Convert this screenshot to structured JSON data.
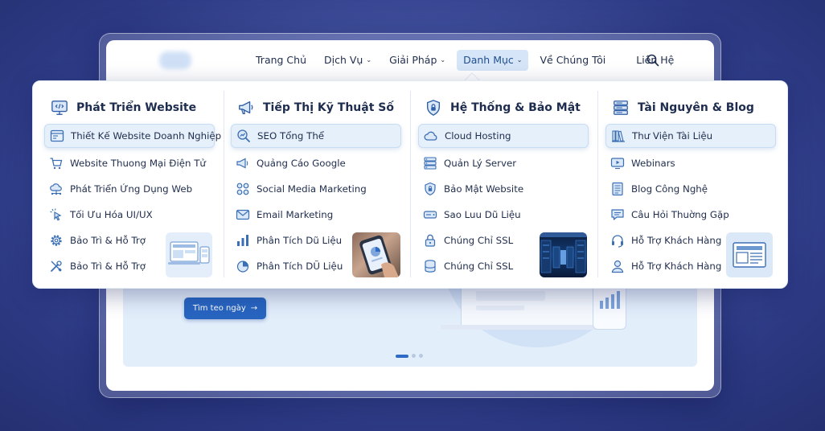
{
  "nav": {
    "items": [
      {
        "label": "Trang Chủ",
        "dropdown": false
      },
      {
        "label": "Dịch Vụ",
        "dropdown": true
      },
      {
        "label": "Giải Pháp",
        "dropdown": true
      },
      {
        "label": "Danh Mục",
        "dropdown": true,
        "active": true
      },
      {
        "label": "Về Chúng Tôi",
        "dropdown": false
      },
      {
        "label": "Liên Hệ",
        "dropdown": false
      }
    ],
    "chevron": "⌄"
  },
  "hero": {
    "button_label": "Tìm teo ngày",
    "button_arrow": "→"
  },
  "menu": {
    "columns": [
      {
        "title": "Phát Triển Website",
        "icon": "code-monitor-icon",
        "items": [
          {
            "label": "Thiết Kế Website Doanh Nghiệp",
            "icon": "browser-window-icon",
            "highlighted": true
          },
          {
            "label": "Website Thuong Mại Điện Tử",
            "icon": "shopping-cart-icon"
          },
          {
            "label": "Phát Triển Ứng Dụng Web",
            "icon": "cloud-network-icon"
          },
          {
            "label": "Tối Ưu Hóa UI/UX",
            "icon": "cursor-click-icon"
          },
          {
            "label": "Bảo Trì & Hỗ Trợ",
            "icon": "gear-icon"
          },
          {
            "label": "Bảo Trì & Hỗ Trợ",
            "icon": "tools-icon"
          }
        ]
      },
      {
        "title": "Tiếp Thị Kỹ Thuật Số",
        "icon": "megaphone-icon",
        "items": [
          {
            "label": "SEO Tổng Thể",
            "icon": "seo-search-icon",
            "highlighted": true
          },
          {
            "label": "Quảng Cáo Google",
            "icon": "megaphone-small-icon"
          },
          {
            "label": "Social Media Marketing",
            "icon": "social-dots-icon"
          },
          {
            "label": "Email Marketing",
            "icon": "envelope-icon"
          },
          {
            "label": "Phân Tích Dũ Liệu",
            "icon": "bar-chart-icon"
          },
          {
            "label": "Phân Tích DŨ Liệu",
            "icon": "pie-chart-icon"
          }
        ]
      },
      {
        "title": "Hệ Thống & Bảo Mật",
        "icon": "shield-lock-icon",
        "items": [
          {
            "label": "Cloud Hosting",
            "icon": "cloud-icon",
            "highlighted": true
          },
          {
            "label": "Quản Lý Server",
            "icon": "server-icon"
          },
          {
            "label": "Bảo Mật Website",
            "icon": "lock-shield-icon"
          },
          {
            "label": "Sao Luu Dũ Liệu",
            "icon": "hard-drive-icon"
          },
          {
            "label": "Chúng Chỉ SSL",
            "icon": "ssl-lock-icon"
          },
          {
            "label": "Chúng Chỉ SSL",
            "icon": "database-icon"
          }
        ]
      },
      {
        "title": "Tài Nguyên & Blog",
        "icon": "stack-icon",
        "items": [
          {
            "label": "Thư Viện Tài Liệu",
            "icon": "library-books-icon",
            "highlighted": true
          },
          {
            "label": "Webinars",
            "icon": "video-play-icon"
          },
          {
            "label": "Blog Công Nghệ",
            "icon": "document-icon"
          },
          {
            "label": "Câu Hỏi Thuờng Gặp",
            "icon": "chat-bubble-icon"
          },
          {
            "label": "Hỗ Trợ Khách Hàng",
            "icon": "headset-icon"
          },
          {
            "label": "Hỗ Trợ Khách Hàng",
            "icon": "user-icon"
          }
        ]
      }
    ]
  },
  "colors": {
    "accent": "#2f6bc4",
    "active_nav_bg": "#d6e6f8",
    "highlight_bg": "#e6f0fb",
    "icon_stroke": "#3b6fb5",
    "background": "#3a4895"
  }
}
